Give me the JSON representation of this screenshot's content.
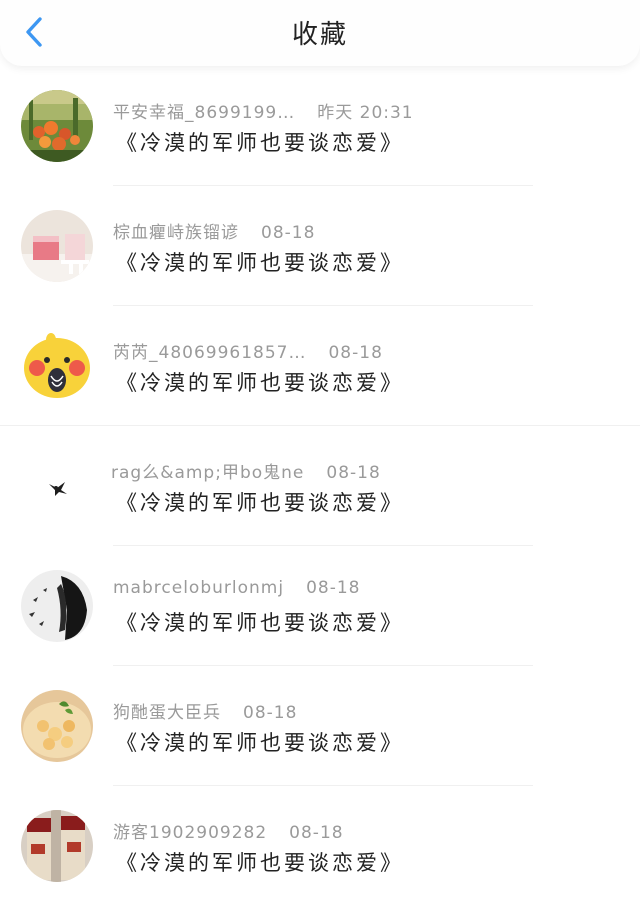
{
  "nav": {
    "title": "收藏"
  },
  "colors": {
    "accent": "#3d97f2",
    "text": "#222222",
    "meta": "#9a9a9a"
  },
  "items": [
    {
      "user": "平安幸福_8699199…",
      "time": "昨天 20:31",
      "book": "《冷漠的军师也要谈恋爱》",
      "avatar": "tulip-garden"
    },
    {
      "user": "棕血癯峙族镏谚",
      "time": "08-18",
      "book": "《冷漠的军师也要谈恋爱》",
      "avatar": "pink-cake"
    },
    {
      "user": "芮芮_48069961857…",
      "time": "08-18",
      "book": "《冷漠的军师也要谈恋爱》",
      "avatar": "yellow-chick"
    },
    {
      "user": "rag么&amp;甲bo鬼ne",
      "time": "08-18",
      "book": "《冷漠的军师也要谈恋爱》",
      "avatar": "swallow-bird"
    },
    {
      "user": "mabrceloburlonmj",
      "time": "08-18",
      "book": "《冷漠的军师也要谈恋爱》",
      "avatar": "black-white-figure"
    },
    {
      "user": "狗酏蛋大臣兵",
      "time": "08-18",
      "book": "《冷漠的军师也要谈恋爱》",
      "avatar": "food-dish"
    },
    {
      "user": "游客1902909282",
      "time": "08-18",
      "book": "《冷漠的军师也要谈恋爱》",
      "avatar": "cups"
    }
  ]
}
